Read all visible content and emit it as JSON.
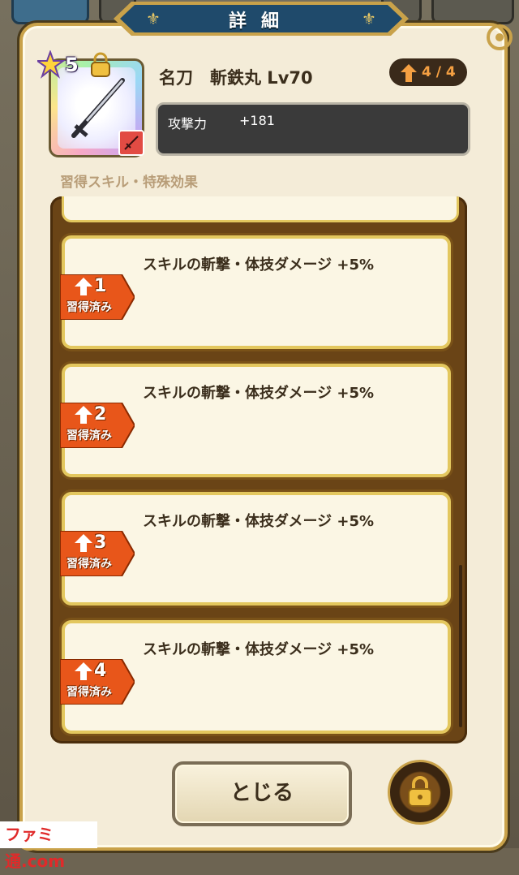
{
  "dialog": {
    "title": "詳細",
    "close_label": "とじる"
  },
  "item": {
    "rarity": "5",
    "name": "名刀　斬鉄丸 Lv70",
    "limit_break": "4 / 4",
    "stat_label": "攻撃力",
    "stat_value": "+181"
  },
  "skills_section": {
    "label": "習得スキル・特殊効果",
    "items": [
      {
        "rank": "1",
        "status": "習得済み",
        "text": "スキルの斬撃・体技ダメージ +5%"
      },
      {
        "rank": "2",
        "status": "習得済み",
        "text": "スキルの斬撃・体技ダメージ +5%"
      },
      {
        "rank": "3",
        "status": "習得済み",
        "text": "スキルの斬撃・体技ダメージ +5%"
      },
      {
        "rank": "4",
        "status": "習得済み",
        "text": "スキルの斬撃・体技ダメージ +5%"
      }
    ]
  },
  "watermark": "ファミ通.com",
  "colors": {
    "accent_gold": "#c9a24a",
    "tag_orange": "#e8561a",
    "banner_blue": "#1f4a6b"
  }
}
